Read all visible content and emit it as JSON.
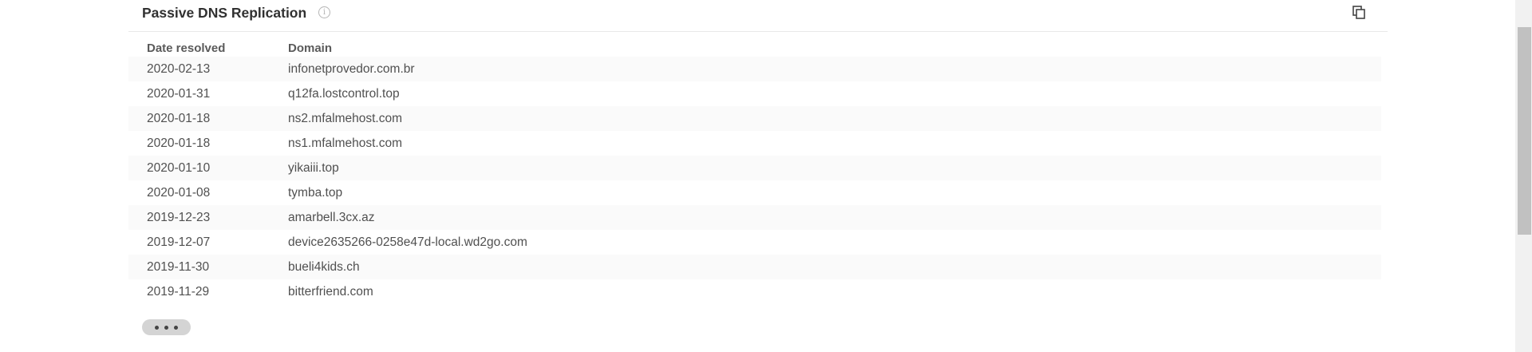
{
  "section": {
    "title": "Passive DNS Replication",
    "info_glyph": "i",
    "copy_icon": "copy-icon"
  },
  "table": {
    "headers": {
      "date": "Date resolved",
      "domain": "Domain"
    },
    "rows": [
      {
        "date": "2020-02-13",
        "domain": "infonetprovedor.com.br"
      },
      {
        "date": "2020-01-31",
        "domain": "q12fa.lostcontrol.top"
      },
      {
        "date": "2020-01-18",
        "domain": "ns2.mfalmehost.com"
      },
      {
        "date": "2020-01-18",
        "domain": "ns1.mfalmehost.com"
      },
      {
        "date": "2020-01-10",
        "domain": "yikaiii.top"
      },
      {
        "date": "2020-01-08",
        "domain": "tymba.top"
      },
      {
        "date": "2019-12-23",
        "domain": "amarbell.3cx.az"
      },
      {
        "date": "2019-12-07",
        "domain": "device2635266-0258e47d-local.wd2go.com"
      },
      {
        "date": "2019-11-30",
        "domain": "bueli4kids.ch"
      },
      {
        "date": "2019-11-29",
        "domain": "bitterfriend.com"
      }
    ]
  },
  "more_button": {
    "icon": "more-dots-icon"
  },
  "colors": {
    "title": "#313131",
    "text": "#505050",
    "row_alt": "#fafafa",
    "more_button_bg": "#d4d4d4",
    "scrollbar_thumb": "#c1c1c1"
  }
}
